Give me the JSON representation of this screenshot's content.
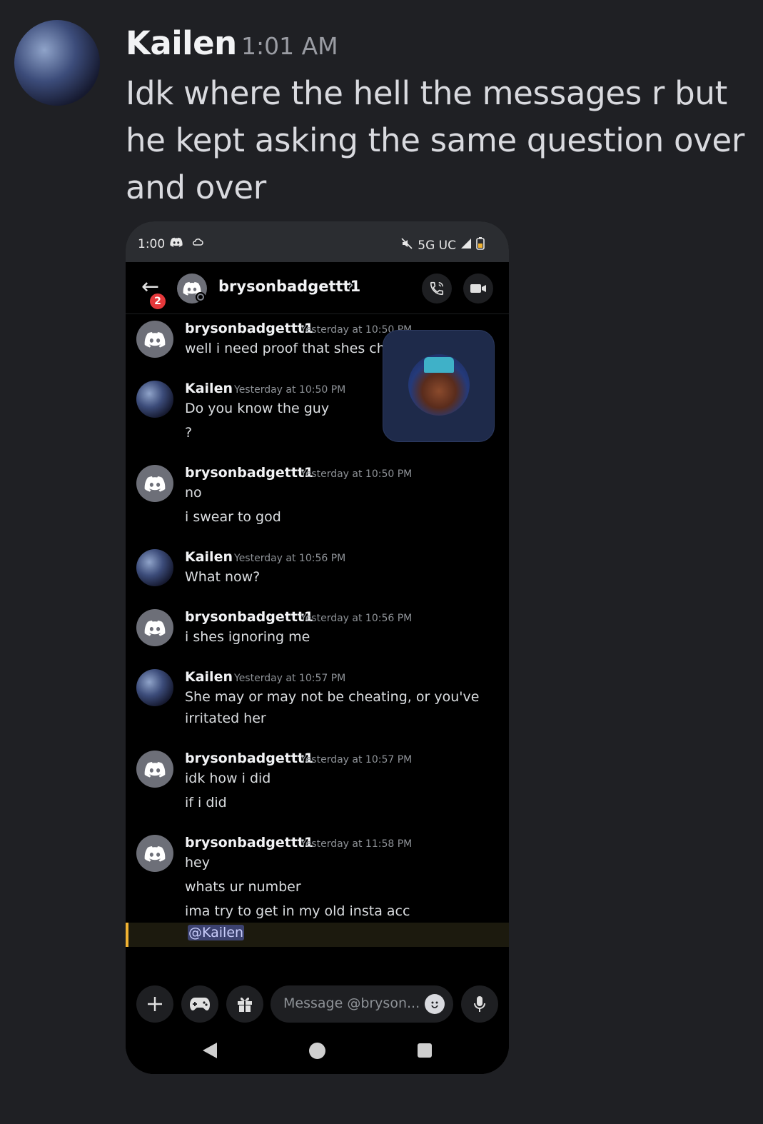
{
  "outer": {
    "username": "Kailen",
    "time": "1:01 AM",
    "text": "Idk where the hell the messages r but he kept asking the same question over and over"
  },
  "phone": {
    "status_bar": {
      "time": "1:00",
      "network": "5G UC",
      "icons": [
        "discord-icon",
        "cloud-icon",
        "mute-icon",
        "signal-icon",
        "battery-icon"
      ]
    },
    "header": {
      "badge_count": "2",
      "username": "brysonbadgettt1",
      "chevron": "›"
    },
    "messages": [
      {
        "author": "brysonbadgettt1",
        "timestamp": "Yesterday at 10:50 PM",
        "lines": [
          "well i need proof that shes che"
        ]
      },
      {
        "author": "Kailen",
        "timestamp": "Yesterday at 10:50 PM",
        "lines": [
          "Do you know the guy",
          "?"
        ]
      },
      {
        "author": "brysonbadgettt1",
        "timestamp": "Yesterday at 10:50 PM",
        "lines": [
          "no",
          "i swear to god"
        ]
      },
      {
        "author": "Kailen",
        "timestamp": "Yesterday at 10:56 PM",
        "lines": [
          "What now?"
        ]
      },
      {
        "author": "brysonbadgettt1",
        "timestamp": "Yesterday at 10:56 PM",
        "lines": [
          "i shes ignoring me"
        ]
      },
      {
        "author": "Kailen",
        "timestamp": "Yesterday at 10:57 PM",
        "lines": [
          "She may or may not be cheating, or you've",
          "irritated her"
        ]
      },
      {
        "author": "brysonbadgettt1",
        "timestamp": "Yesterday at 10:57 PM",
        "lines": [
          "idk how i did",
          "if i did"
        ]
      },
      {
        "author": "brysonbadgettt1",
        "timestamp": "Yesterday at 11:58 PM",
        "lines": [
          "hey",
          "whats ur number",
          "ima try to get in my old insta acc"
        ]
      }
    ],
    "mention": "@Kailen",
    "composer": {
      "placeholder": "Message @bryson..."
    }
  }
}
